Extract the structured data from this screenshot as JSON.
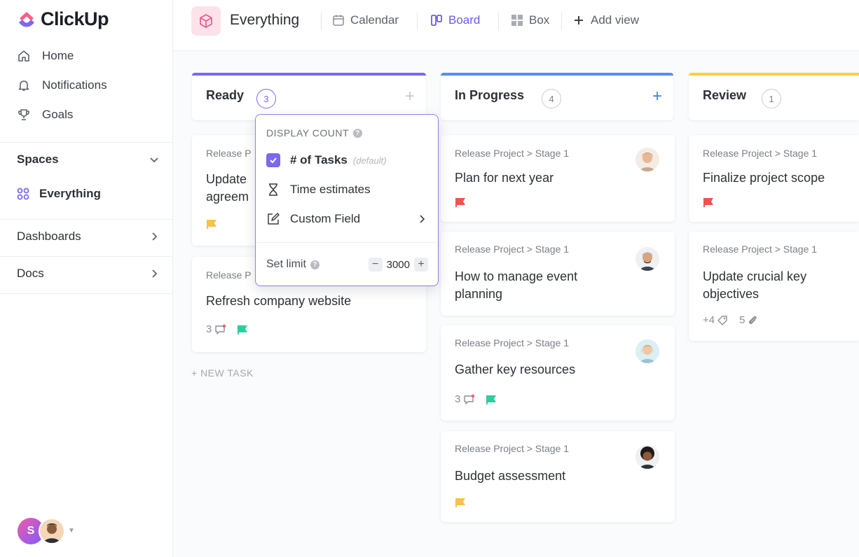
{
  "app": {
    "name": "ClickUp"
  },
  "sidebar": {
    "items": [
      {
        "label": "Home",
        "icon": "home-icon"
      },
      {
        "label": "Notifications",
        "icon": "bell-icon"
      },
      {
        "label": "Goals",
        "icon": "trophy-icon"
      }
    ],
    "spaces_label": "Spaces",
    "everything_label": "Everything",
    "dashboards_label": "Dashboards",
    "docs_label": "Docs",
    "user_initial": "S"
  },
  "topbar": {
    "title": "Everything",
    "views": [
      {
        "label": "Calendar",
        "icon": "calendar-icon",
        "active": false
      },
      {
        "label": "Board",
        "icon": "board-icon",
        "active": true
      },
      {
        "label": "Box",
        "icon": "box-icon",
        "active": false
      },
      {
        "label": "Add view",
        "icon": "plus-icon",
        "active": false
      }
    ]
  },
  "columns": [
    {
      "name": "Ready",
      "count": "3",
      "color": "#7b68ee",
      "cards": [
        {
          "crumb": "Release P",
          "title_lines": [
            "Update",
            "agreem"
          ],
          "flag": "#f8c244"
        },
        {
          "crumb": "Release P",
          "title": "Refresh company website",
          "comments": "3",
          "flag": "#2ecd9f"
        }
      ],
      "new_task": "+ NEW TASK"
    },
    {
      "name": "In Progress",
      "count": "4",
      "color": "#5a8dee",
      "cards": [
        {
          "crumb": "Release Project > Stage 1",
          "title": "Plan for next year",
          "flag": "#ef5350"
        },
        {
          "crumb": "Release Project > Stage 1",
          "title_lines": [
            "How to manage event",
            "planning"
          ]
        },
        {
          "crumb": "Release Project > Stage 1",
          "title": "Gather key resources",
          "comments": "3",
          "flag": "#2ecd9f"
        },
        {
          "crumb": "Release Project > Stage 1",
          "title": "Budget assessment",
          "flag": "#f8c244"
        }
      ]
    },
    {
      "name": "Review",
      "count": "1",
      "color": "#f7d23b",
      "cards": [
        {
          "crumb": "Release Project > Stage 1",
          "title": "Finalize project scope",
          "flag": "#ef5350"
        },
        {
          "crumb": "Release Project > Stage 1",
          "title_lines": [
            "Update crucial key",
            "objectives"
          ],
          "tags": "+4",
          "attachments": "5"
        }
      ]
    }
  ],
  "popup": {
    "header": "DISPLAY COUNT",
    "options": [
      {
        "label": "# of Tasks",
        "hint": "(default)",
        "checked": true
      },
      {
        "label": "Time estimates"
      },
      {
        "label": "Custom Field"
      }
    ],
    "limit_label": "Set limit",
    "limit_value": "3000"
  }
}
